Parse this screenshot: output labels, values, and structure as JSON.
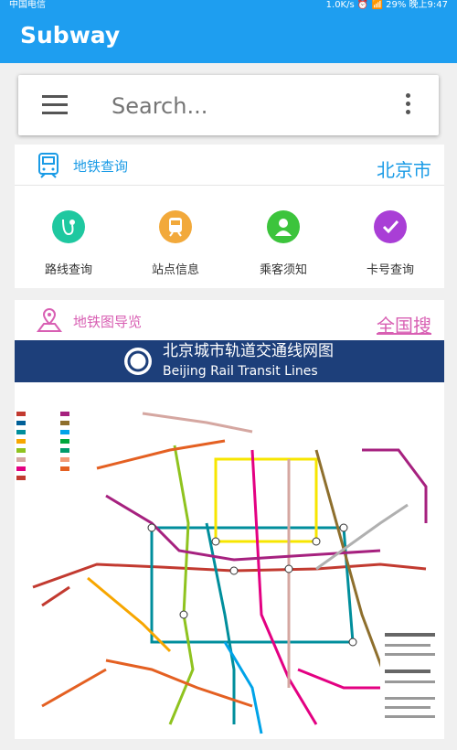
{
  "status": {
    "carrier": "中国电信",
    "right": "1.0K/s ⏰ 📶 29% 晚上9:47"
  },
  "app": {
    "title": "Subway"
  },
  "search": {
    "placeholder": "Search..."
  },
  "query_card": {
    "header_label": "地铁查询",
    "city": "北京市",
    "features": [
      {
        "label": "路线查询",
        "icon": "route-icon",
        "color": "#1fc8a0"
      },
      {
        "label": "站点信息",
        "icon": "train-icon",
        "color": "#f2a93b"
      },
      {
        "label": "乘客须知",
        "icon": "person-icon",
        "color": "#3cc43c"
      },
      {
        "label": "卡号查询",
        "icon": "check-icon",
        "color": "#a93ed6"
      }
    ]
  },
  "map_card": {
    "header_label": "地铁图导览",
    "search_all": "全国搜",
    "map_title_cn": "北京城市轨道交通线网图",
    "map_title_en": "Beijing Rail Transit Lines"
  },
  "colors": {
    "primary": "#1e9ef0",
    "accent_pink": "#d85fb3",
    "map_header": "#1d3f7a"
  }
}
